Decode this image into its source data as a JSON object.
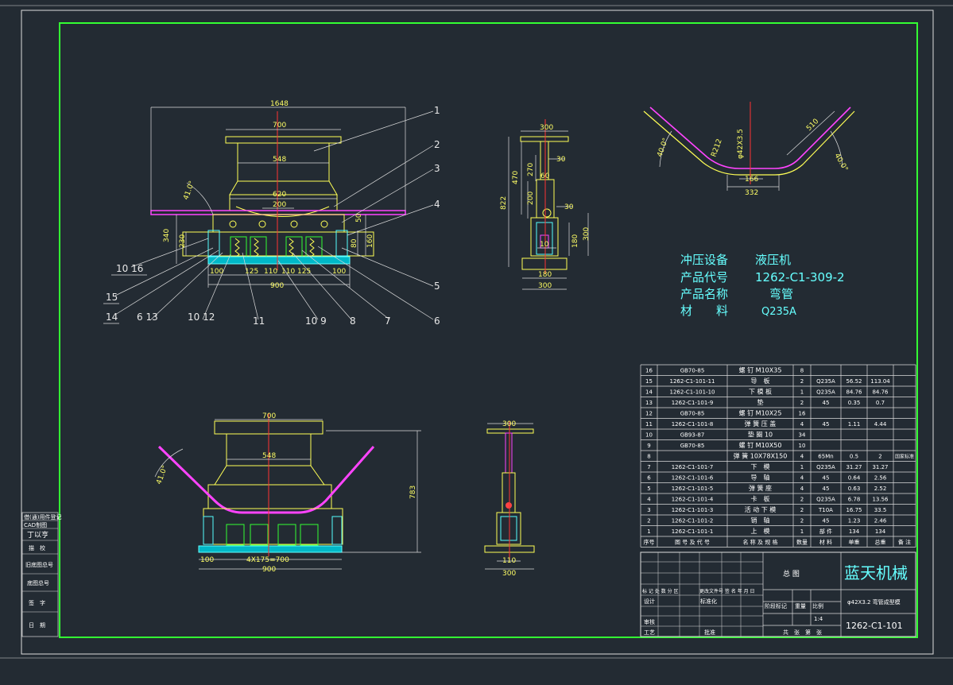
{
  "main_view": {
    "dims": {
      "d1648": "1648",
      "d700": "700",
      "d548": "548",
      "d620": "620",
      "d200": "200",
      "d340": "340",
      "d230": "230",
      "d160": "160",
      "d80": "80",
      "d50": "50",
      "d100a": "100",
      "d125a": "125",
      "d110a": "110",
      "d110b": "110",
      "d125b": "125",
      "d100b": "100",
      "d900": "900",
      "angle": "41.0°"
    },
    "balloons": {
      "b1": "1",
      "b2": "2",
      "b3": "3",
      "b4": "4",
      "b5": "5",
      "b6": "6",
      "b7": "7",
      "b8": "8",
      "b10_9": "10 9",
      "b11": "11",
      "b10_12": "10 12",
      "b6_13": "6 13",
      "b14": "14",
      "b15": "15",
      "b10_16": "10 16"
    }
  },
  "side_view": {
    "dims": {
      "d300": "300",
      "d30a": "30",
      "d60": "60",
      "d470": "470",
      "d270": "270",
      "d822": "822",
      "d200": "200",
      "d30b": "30",
      "d10": "10",
      "d180a": "180",
      "d300b": "300",
      "d180b": "180",
      "d300c": "300"
    }
  },
  "bend_view": {
    "dims": {
      "a1": "40.0°",
      "r212": "R212",
      "pipe": "φ42X3.5",
      "d510": "510",
      "a2": "40.0°",
      "d166": "166",
      "d332": "332"
    }
  },
  "bottom_view": {
    "dims": {
      "d700": "700",
      "d548": "548",
      "angle": "41.0°",
      "d783": "783",
      "d100": "100",
      "d4x175": "4X175=700",
      "d900": "900"
    }
  },
  "bottom_side_view": {
    "dims": {
      "d300": "300",
      "d110": "110",
      "d300b": "300"
    }
  },
  "product_info": {
    "row1_label": "冲压设备",
    "row1_value": "液压机",
    "row2_label": "产品代号",
    "row2_value": "1262-C1-309-2",
    "row3_label": "产品名称",
    "row3_value": "弯管",
    "row4_label": "材　　料",
    "row4_value": "Q235A"
  },
  "bom": {
    "rows": [
      [
        "16",
        "GB70-85",
        "螺 钉 M10X35",
        "8",
        "",
        "",
        ""
      ],
      [
        "15",
        "1262-C1-101-11",
        "导　板",
        "2",
        "Q235A",
        "56.52",
        "113.04"
      ],
      [
        "14",
        "1262-C1-101-10",
        "下 模 板",
        "1",
        "Q235A",
        "84.76",
        "84.76"
      ],
      [
        "13",
        "1262-C1-101-9",
        "垫",
        "2",
        "45",
        "0.35",
        "0.7"
      ],
      [
        "12",
        "GB70-85",
        "螺 钉 M10X25",
        "16",
        "",
        "",
        ""
      ],
      [
        "11",
        "1262-C1-101-8",
        "弹 簧 压 盖",
        "4",
        "45",
        "1.11",
        "4.44"
      ],
      [
        "10",
        "GB93-87",
        "垫 圈 10",
        "34",
        "",
        "",
        ""
      ],
      [
        "9",
        "GB70-85",
        "螺 钉 M10X50",
        "10",
        "",
        "",
        ""
      ],
      [
        "8",
        "",
        "弹 簧 10X78X150",
        "4",
        "65Mn",
        "0.5",
        "2"
      ],
      [
        "7",
        "1262-C1-101-7",
        "下　模",
        "1",
        "Q235A",
        "31.27",
        "31.27"
      ],
      [
        "6",
        "1262-C1-101-6",
        "导　轴",
        "4",
        "45",
        "0.64",
        "2.56"
      ],
      [
        "5",
        "1262-C1-101-5",
        "弹 簧 座",
        "4",
        "45",
        "0.63",
        "2.52"
      ],
      [
        "4",
        "1262-C1-101-4",
        "卡　板",
        "2",
        "Q235A",
        "6.78",
        "13.56"
      ],
      [
        "3",
        "1262-C1-101-3",
        "活 动 下 模",
        "2",
        "T10A",
        "16.75",
        "33.5"
      ],
      [
        "2",
        "1262-C1-101-2",
        "销　轴",
        "2",
        "45",
        "1.23",
        "2.46"
      ],
      [
        "1",
        "1262-C1-101-1",
        "上　模",
        "1",
        "部 件",
        "134",
        "134"
      ]
    ],
    "row8_extra": "国家标准",
    "header": [
      "序号",
      "图 号 及 代 号",
      "名 称 及 规 格",
      "数量",
      "材 料",
      "单重",
      "总重",
      "备 注"
    ]
  },
  "title_block": {
    "drawing_name": "总 图",
    "company": "蓝天机械",
    "part_desc": "φ42X3.2 弯管成型模",
    "drawing_no": "1262-C1-101",
    "revision_hdr": "标 记 处 数 分 区",
    "revision_hdr2": "更改文件号 签 名 年 月 日",
    "design": "设计",
    "standardize": "标准化",
    "stage_mark": "阶段标记",
    "weight": "重量",
    "scale": "比例",
    "scale_value": "1:4",
    "review": "审核",
    "process": "工艺",
    "approve": "批准",
    "sheets": "共　张　第　张"
  },
  "side_strip": {
    "s1": "借(通)用件登记",
    "s2": "CAD制图",
    "s3": "丁以亨",
    "s4": "描　校",
    "s5": "旧底图总号",
    "s6": "底图总号",
    "s7": "签　字",
    "s8": "日　期"
  }
}
